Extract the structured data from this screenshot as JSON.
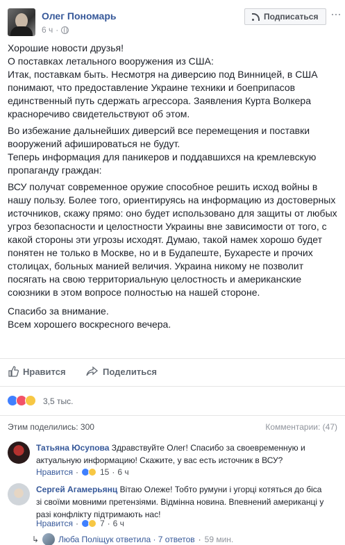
{
  "post": {
    "author": "Олег Пономарь",
    "time": "6 ч",
    "subscribe_label": "Подписаться",
    "menu_label": "···",
    "paragraphs": [
      "Хорошие новости друзья!\nО поставках летального вооружения из США:\nИтак, поставкам быть. Несмотря на диверсию под Винницей, в США понимают, что предоставление Украине техники и боеприпасов единственный путь сдержать агрессора. Заявления Курта Волкера красноречиво свидетельствуют об этом.",
      "Во избежание дальнейших диверсий все перемещения и поставки вооружений афишироваться не будут.\nТеперь информация для паникеров и поддавшихся на кремлевскую пропаганду граждан:",
      "ВСУ получат современное оружие способное решить исход войны в нашу пользу. Более того, ориентируясь на информацию из достоверных источников, скажу прямо: оно будет использовано для защиты от любых угроз безопасности и целостности Украины вне зависимости от того, с какой стороны эти угрозы исходят. Думаю, такой намек хорошо будет понятен не только в Москве, но и в Будапеште, Бухаресте и прочих столицах, больных манией величия. Украина никому не позволит посягать на свою территориальную целостность и американские союзники в этом вопросе полностью на нашей стороне.",
      "Спасибо за внимание.\nВсем хорошего воскресного вечера."
    ]
  },
  "actions": {
    "like_label": "Нравится",
    "share_label": "Поделиться"
  },
  "reactions": {
    "count": "3,5 тыс.",
    "types": [
      "like",
      "love",
      "sad"
    ]
  },
  "shares": {
    "shared_by": "Этим поделились: 300",
    "comments": "Комментарии: (47)"
  },
  "comments": [
    {
      "name": "Татьяна Юсупова",
      "text": "Здравствуйте Олег! Спасибо за своевременную и актуальную информацию! Скажите, у вас есть источник в ВСУ?",
      "like_label": "Нравится",
      "reaction_count": "15",
      "time": "6 ч"
    },
    {
      "name": "Сергей Агамерьянц",
      "text": "Вітаю Олеже! Тобто румуни і угорці котяться до біса зі своїми мовними претензіями. Відмінна новина. Впевнений американці у разі конфлікту підтримають нас!",
      "like_label": "Нравится",
      "reaction_count": "7",
      "time": "6 ч"
    }
  ],
  "reply": {
    "arrow": "↳",
    "text": "Люба Поліщук ответила · 7 ответов",
    "time": "59 мин."
  }
}
